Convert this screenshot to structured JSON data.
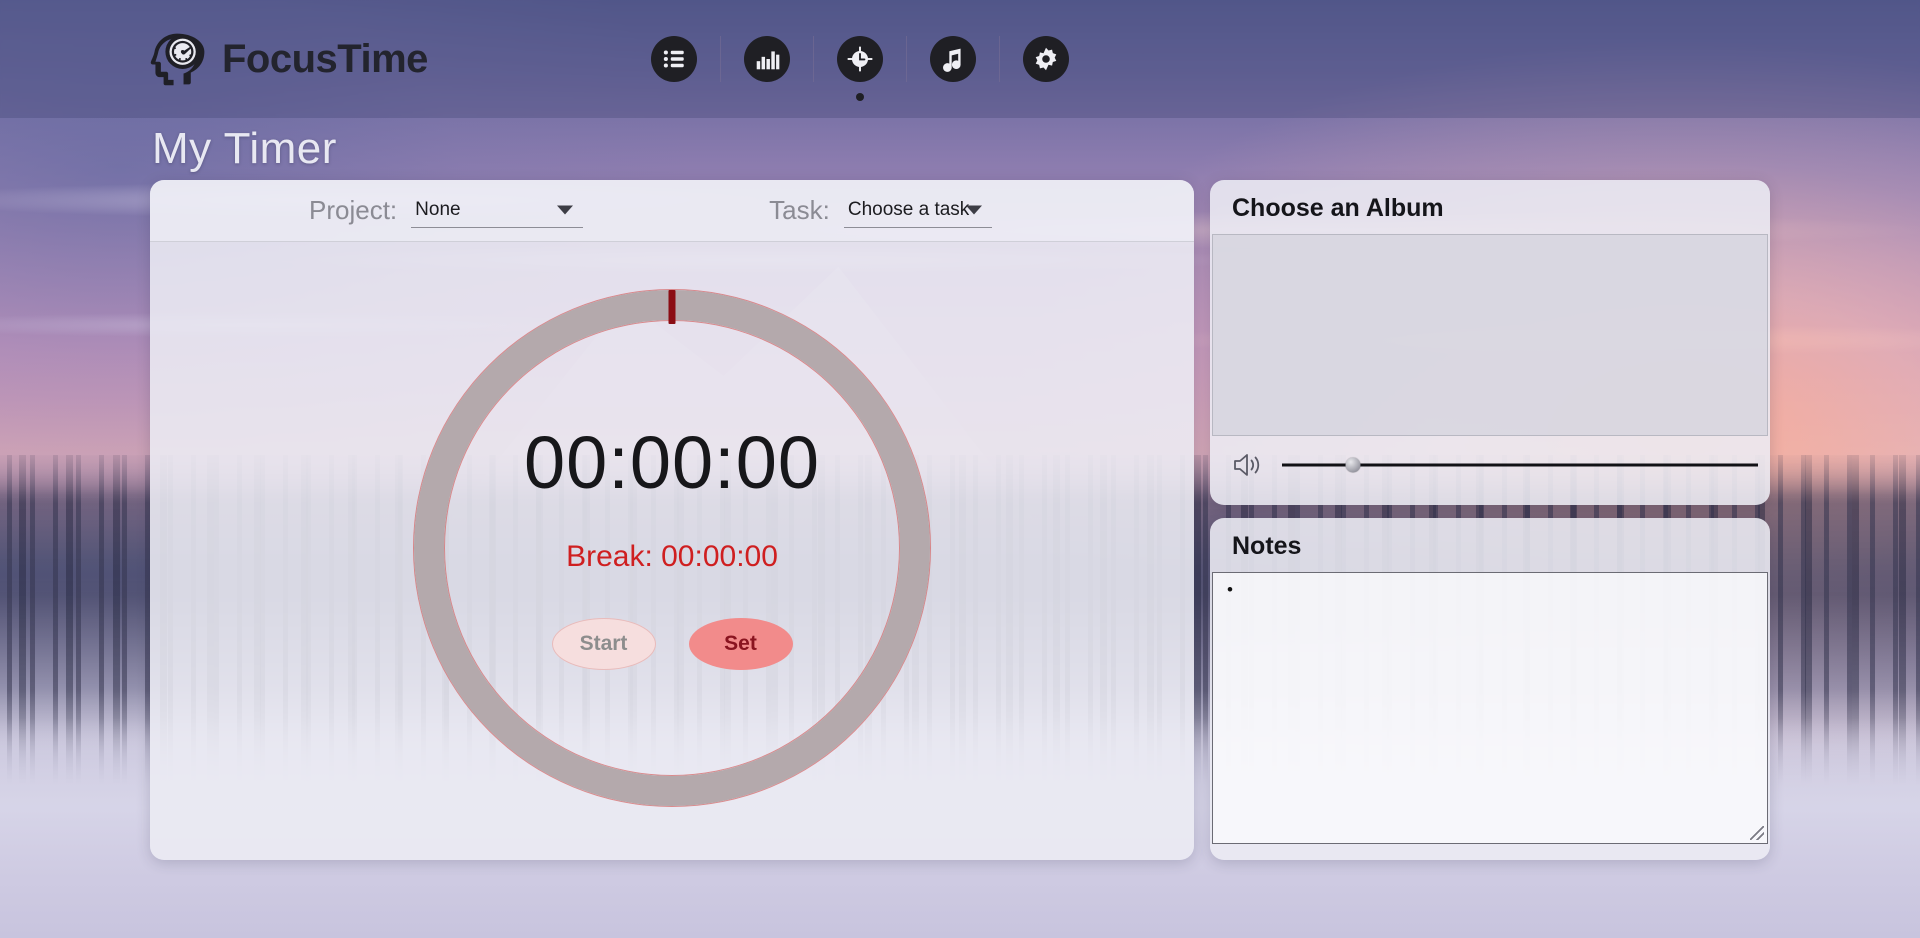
{
  "header": {
    "brand": "FocusTime",
    "brand_icon": "head-with-gauge-logo",
    "nav": [
      {
        "id": "tasks",
        "icon": "list-icon",
        "label": "Tasks",
        "active": false
      },
      {
        "id": "stats",
        "icon": "bar-chart-icon",
        "label": "Stats",
        "active": false
      },
      {
        "id": "timer",
        "icon": "target-clock-icon",
        "label": "Timer",
        "active": true
      },
      {
        "id": "music",
        "icon": "music-note-icon",
        "label": "Music",
        "active": false
      },
      {
        "id": "settings",
        "icon": "gear-icon",
        "label": "Settings",
        "active": false
      }
    ]
  },
  "page": {
    "title": "My Timer"
  },
  "timer": {
    "project_label": "Project:",
    "project_value": "None",
    "task_label": "Task:",
    "task_value": "Choose a task",
    "display": "00:00:00",
    "break_label": "Break: 00:00:00",
    "start_button": "Start",
    "set_button": "Set",
    "ring_color": "#b4a9ac",
    "ring_outline_color": "#d66a6a",
    "tick_color": "#8b0d14",
    "break_color": "#cf1f20",
    "set_button_color": "#f28b8b",
    "set_button_text_color": "#8a1420",
    "start_button_color": "#f6dede",
    "start_button_text_color": "#8d8d8d"
  },
  "album": {
    "title": "Choose an Album",
    "list_selected": "",
    "volume_icon": "speaker-volume-icon",
    "volume_percent": 15
  },
  "notes": {
    "title": "Notes",
    "content": "•",
    "placeholder": ""
  }
}
